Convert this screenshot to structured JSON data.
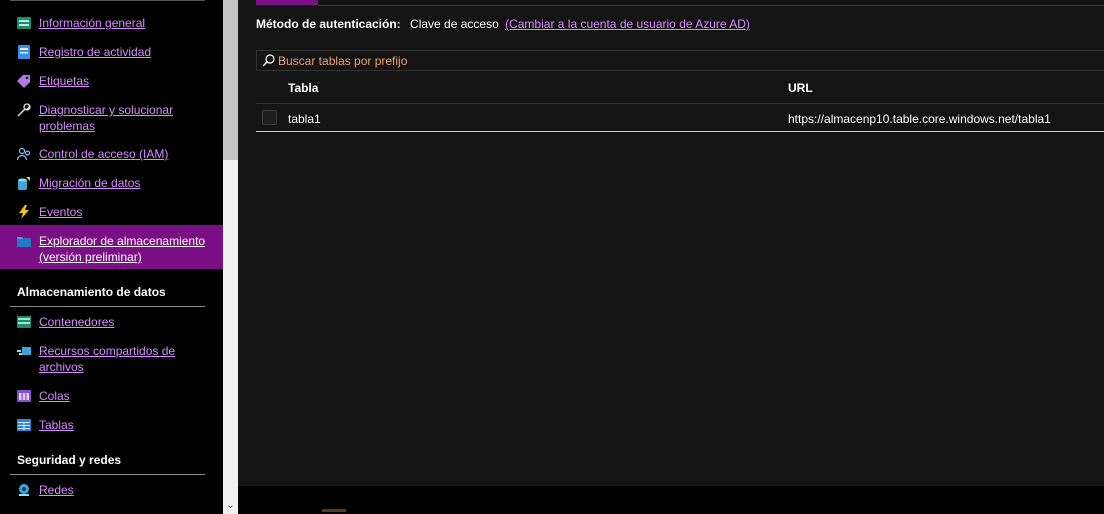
{
  "sidebar": {
    "items": [
      {
        "label": "Información general",
        "icon": "overview-icon"
      },
      {
        "label": "Registro de actividad",
        "icon": "activity-log-icon"
      },
      {
        "label": "Etiquetas",
        "icon": "tag-icon"
      },
      {
        "label": "Diagnosticar y solucionar problemas",
        "icon": "wrench-icon"
      },
      {
        "label": "Control de acceso (IAM)",
        "icon": "people-icon"
      },
      {
        "label": "Migración de datos",
        "icon": "data-migration-icon"
      },
      {
        "label": "Eventos",
        "icon": "lightning-icon"
      },
      {
        "label": "Explorador de almacenamiento (versión preliminar)",
        "icon": "storage-explorer-icon",
        "selected": true
      }
    ],
    "sections": [
      {
        "title": "Almacenamiento de datos",
        "items": [
          {
            "label": "Contenedores",
            "icon": "containers-icon"
          },
          {
            "label": "Recursos compartidos de archivos",
            "icon": "file-shares-icon"
          },
          {
            "label": "Colas",
            "icon": "queues-icon"
          },
          {
            "label": "Tablas",
            "icon": "tables-icon"
          }
        ]
      },
      {
        "title": "Seguridad y redes",
        "items": [
          {
            "label": "Redes",
            "icon": "networking-icon"
          }
        ]
      }
    ]
  },
  "main": {
    "auth": {
      "label": "Método de autenticación:",
      "value": "Clave de acceso",
      "link": "(Cambiar a la cuenta de usuario de Azure AD)"
    },
    "search": {
      "placeholder": "Buscar tablas por prefijo",
      "value": ""
    },
    "table": {
      "columns": [
        "Tabla",
        "URL"
      ],
      "rows": [
        {
          "name": "tabla1",
          "url": "https://almacenp10.table.core.windows.net/tabla1"
        }
      ]
    }
  },
  "colors": {
    "accent": "#7b0f86",
    "link": "#d98cff",
    "placeholder": "#f0a070",
    "background": "#141414"
  }
}
